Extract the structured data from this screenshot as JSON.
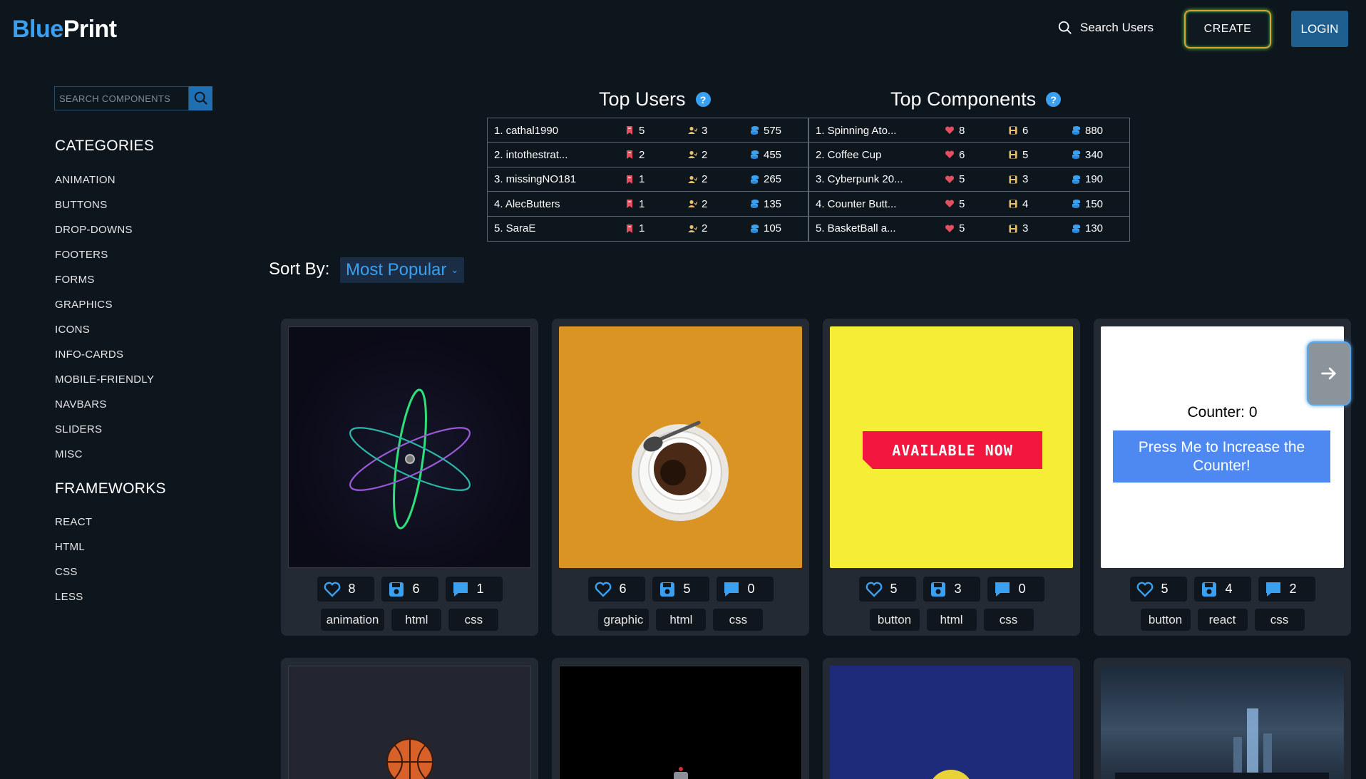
{
  "header": {
    "logo_part1": "Blue",
    "logo_part2": "Print",
    "search_users_label": "Search Users",
    "create_label": "CREATE",
    "login_label": "LOGIN"
  },
  "sidebar": {
    "search_placeholder": "SEARCH COMPONENTS",
    "categories_heading": "CATEGORIES",
    "categories": [
      "ANIMATION",
      "BUTTONS",
      "DROP-DOWNS",
      "FOOTERS",
      "FORMS",
      "GRAPHICS",
      "ICONS",
      "INFO-CARDS",
      "MOBILE-FRIENDLY",
      "NAVBARS",
      "SLIDERS",
      "MISC"
    ],
    "frameworks_heading": "FRAMEWORKS",
    "frameworks": [
      "REACT",
      "HTML",
      "CSS",
      "LESS"
    ]
  },
  "top_users": {
    "title": "Top Users",
    "help": "?",
    "rows": [
      {
        "name": "1. cathal1990",
        "bookmarks": "5",
        "followers": "3",
        "coins": "575"
      },
      {
        "name": "2. intothestrat...",
        "bookmarks": "2",
        "followers": "2",
        "coins": "455"
      },
      {
        "name": "3. missingNO181",
        "bookmarks": "1",
        "followers": "2",
        "coins": "265"
      },
      {
        "name": "4. AlecButters",
        "bookmarks": "1",
        "followers": "2",
        "coins": "135"
      },
      {
        "name": "5. SaraE",
        "bookmarks": "1",
        "followers": "2",
        "coins": "105"
      }
    ]
  },
  "top_components": {
    "title": "Top Components",
    "help": "?",
    "rows": [
      {
        "name": "1. Spinning Ato...",
        "likes": "8",
        "saves": "6",
        "coins": "880"
      },
      {
        "name": "2. Coffee Cup",
        "likes": "6",
        "saves": "5",
        "coins": "340"
      },
      {
        "name": "3. Cyberpunk 20...",
        "likes": "5",
        "saves": "3",
        "coins": "190"
      },
      {
        "name": "4. Counter Butt...",
        "likes": "5",
        "saves": "4",
        "coins": "150"
      },
      {
        "name": "5. BasketBall a...",
        "likes": "5",
        "saves": "3",
        "coins": "130"
      }
    ]
  },
  "sort": {
    "label": "Sort By:",
    "selected": "Most Popular"
  },
  "cards": [
    {
      "likes": "8",
      "saves": "6",
      "comments": "1",
      "tags": [
        "animation",
        "html",
        "css"
      ]
    },
    {
      "likes": "6",
      "saves": "5",
      "comments": "0",
      "tags": [
        "graphic",
        "html",
        "css"
      ]
    },
    {
      "likes": "5",
      "saves": "3",
      "comments": "0",
      "tags": [
        "button",
        "html",
        "css"
      ],
      "preview_text": "AVAILABLE NOW"
    },
    {
      "likes": "5",
      "saves": "4",
      "comments": "2",
      "tags": [
        "button",
        "react",
        "css"
      ],
      "counter_text": "Counter: 0",
      "counter_button": "Press Me to Increase the Counter!"
    }
  ],
  "colors": {
    "background": "#0d151d",
    "accent": "#3aa0f2",
    "card": "#232a33",
    "heart": "#e0505e",
    "bookmark": "#e0505e"
  }
}
